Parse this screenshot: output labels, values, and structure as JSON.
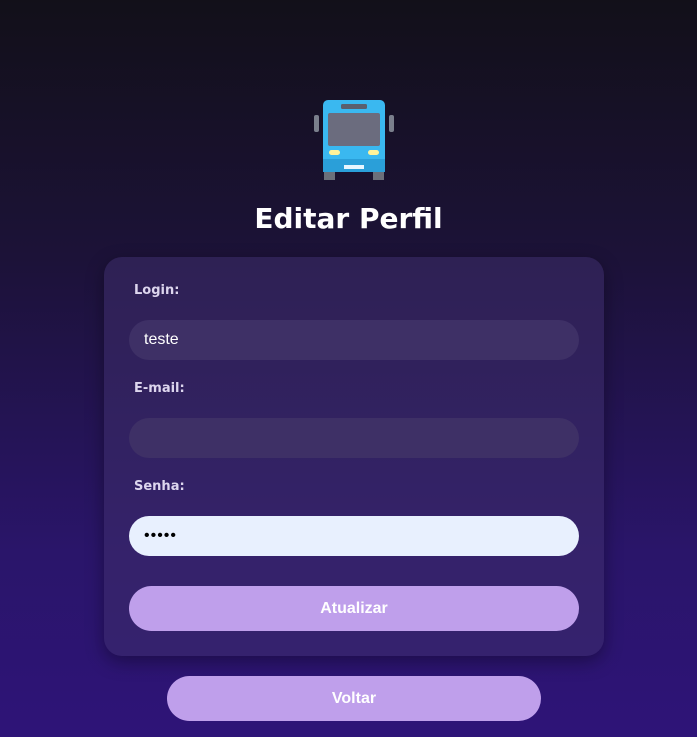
{
  "page": {
    "title": "Editar Perfil",
    "logo_icon": "bus-icon"
  },
  "form": {
    "login_label": "Login:",
    "login_value": "teste",
    "email_label": "E-mail:",
    "email_value": "",
    "password_label": "Senha:",
    "password_value": "teste",
    "submit_label": "Atualizar"
  },
  "back_button_label": "Voltar",
  "colors": {
    "accent_button": "#bf9feb",
    "input_background": "#3e3066",
    "autofill_background": "#e8f0fe",
    "bus_body": "#3ab8f0"
  }
}
